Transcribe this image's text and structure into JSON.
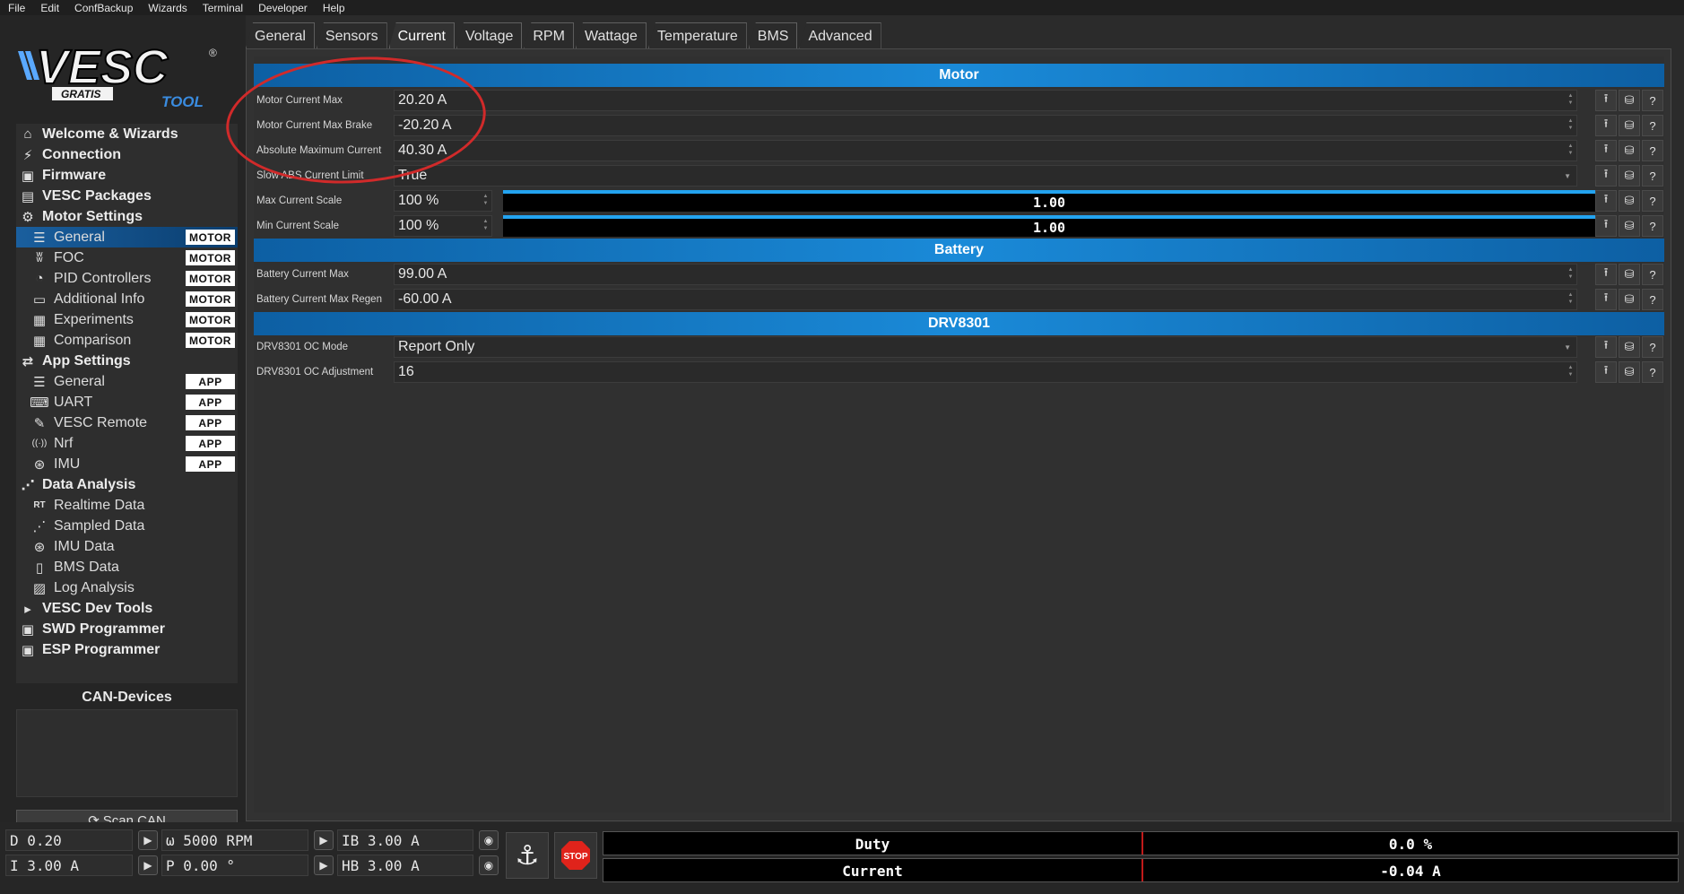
{
  "menubar": [
    "File",
    "Edit",
    "ConfBackup",
    "Wizards",
    "Terminal",
    "Developer",
    "Help"
  ],
  "logo": {
    "brand": "VESC",
    "sub1": "GRATIS",
    "sub2": "TOOL",
    "reg": "®"
  },
  "nav": {
    "items": [
      {
        "label": "Welcome & Wizards",
        "icon": "home-icon",
        "glyph": "⌂"
      },
      {
        "label": "Connection",
        "icon": "plug-icon",
        "glyph": "⚡"
      },
      {
        "label": "Firmware",
        "icon": "chip-icon",
        "glyph": "▣"
      },
      {
        "label": "VESC Packages",
        "icon": "package-icon",
        "glyph": "▤"
      },
      {
        "label": "Motor Settings",
        "icon": "motor-icon",
        "glyph": "⚙"
      },
      {
        "label": "General",
        "icon": "sliders-icon",
        "glyph": "☰",
        "badge": "MOTOR"
      },
      {
        "label": "FOC",
        "icon": "coil-icon",
        "glyph": "ʬ",
        "badge": "MOTOR"
      },
      {
        "label": "PID Controllers",
        "icon": "gauge-icon",
        "glyph": "◔",
        "badge": "MOTOR"
      },
      {
        "label": "Additional Info",
        "icon": "info-icon",
        "glyph": "▭",
        "badge": "MOTOR"
      },
      {
        "label": "Experiments",
        "icon": "calculator-icon",
        "glyph": "▦",
        "badge": "MOTOR"
      },
      {
        "label": "Comparison",
        "icon": "calculator-icon",
        "glyph": "▦",
        "badge": "MOTOR"
      },
      {
        "label": "App Settings",
        "icon": "transfer-icon",
        "glyph": "⇄"
      },
      {
        "label": "General",
        "icon": "sliders-icon",
        "glyph": "☰",
        "badge": "APP"
      },
      {
        "label": "UART",
        "icon": "keyboard-icon",
        "glyph": "⌨",
        "badge": "APP"
      },
      {
        "label": "VESC Remote",
        "icon": "remote-icon",
        "glyph": "✎",
        "badge": "APP"
      },
      {
        "label": "Nrf",
        "icon": "wireless-icon",
        "glyph": "((·))",
        "badge": "APP"
      },
      {
        "label": "IMU",
        "icon": "imu-icon",
        "glyph": "⊛",
        "badge": "APP"
      },
      {
        "label": "Data Analysis",
        "icon": "chart-icon",
        "glyph": "⋰"
      },
      {
        "label": "Realtime Data",
        "icon": "realtime-icon",
        "glyph": "RT"
      },
      {
        "label": "Sampled Data",
        "icon": "chart-icon",
        "glyph": "⋰"
      },
      {
        "label": "IMU Data",
        "icon": "imu-icon",
        "glyph": "⊛"
      },
      {
        "label": "BMS Data",
        "icon": "battery-icon",
        "glyph": "▯"
      },
      {
        "label": "Log Analysis",
        "icon": "map-icon",
        "glyph": "▨"
      },
      {
        "label": "VESC Dev Tools",
        "icon": "terminal-icon",
        "glyph": "▸"
      },
      {
        "label": "SWD Programmer",
        "icon": "chip-icon",
        "glyph": "▣"
      },
      {
        "label": "ESP Programmer",
        "icon": "chip-icon",
        "glyph": "▣"
      }
    ]
  },
  "can": {
    "title": "CAN-Devices",
    "scan_label": "Scan CAN"
  },
  "tabs": [
    "General",
    "Sensors",
    "Current",
    "Voltage",
    "RPM",
    "Wattage",
    "Temperature",
    "BMS",
    "Advanced"
  ],
  "sections": {
    "motor": "Motor",
    "battery": "Battery",
    "drv": "DRV8301"
  },
  "params": {
    "motor_current_max": {
      "label": "Motor Current Max",
      "value": "20.20 A"
    },
    "motor_current_max_brake": {
      "label": "Motor Current Max Brake",
      "value": "-20.20 A"
    },
    "abs_max_current": {
      "label": "Absolute Maximum Current",
      "value": "40.30 A"
    },
    "slow_abs_limit": {
      "label": "Slow ABS Current Limit",
      "value": "True"
    },
    "max_current_scale": {
      "label": "Max Current Scale",
      "value": "100 %",
      "bar": "1.00"
    },
    "min_current_scale": {
      "label": "Min Current Scale",
      "value": "100 %",
      "bar": "1.00"
    },
    "battery_current_max": {
      "label": "Battery Current Max",
      "value": "99.00 A"
    },
    "battery_current_max_regen": {
      "label": "Battery Current Max Regen",
      "value": "-60.00 A"
    },
    "drv_oc_mode": {
      "label": "DRV8301 OC Mode",
      "value": "Report Only"
    },
    "drv_oc_adjustment": {
      "label": "DRV8301 OC Adjustment",
      "value": "16"
    }
  },
  "bottom": {
    "duty": "D 0.20",
    "current": "I 3.00 A",
    "rpm": "ω 5000 RPM",
    "position": "P 0.00 °",
    "brake_current": "IB 3.00 A",
    "handbrake": "HB 3.00 A",
    "stop_label": "STOP",
    "meters": [
      {
        "label": "Duty",
        "value": "0.0 %"
      },
      {
        "label": "Current",
        "value": "-0.04 A"
      }
    ]
  }
}
